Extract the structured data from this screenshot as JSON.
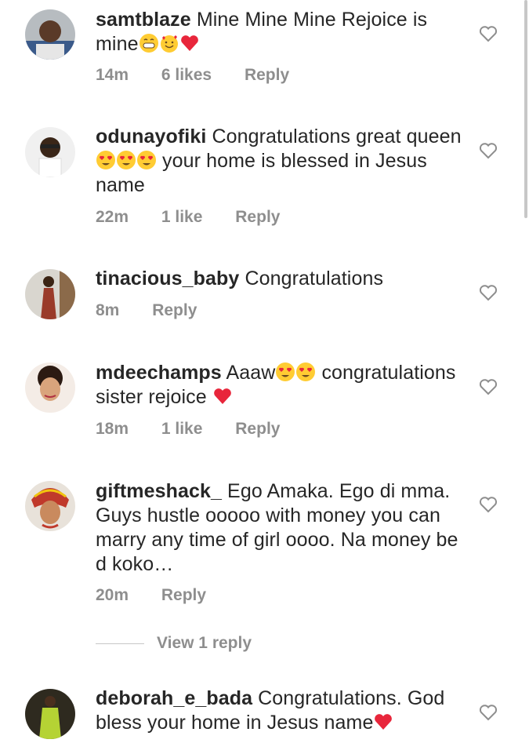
{
  "comments": [
    {
      "username": "samtblaze",
      "text_before": "Mine Mine Mine Rejoice is mine",
      "emojis": [
        "grinning-face",
        "smiling-face-with-hearts",
        "red-heart"
      ],
      "time": "14m",
      "likes": "6 likes",
      "reply": "Reply"
    },
    {
      "username": "odunayofiki",
      "text_before": "Congratulations great queen ",
      "emojis": [
        "heart-eyes",
        "heart-eyes",
        "heart-eyes"
      ],
      "text_after": " your home is blessed in Jesus name",
      "time": "22m",
      "likes": "1 like",
      "reply": "Reply"
    },
    {
      "username": "tinacious_baby",
      "text_before": "Congratulations",
      "time": "8m",
      "reply": "Reply"
    },
    {
      "username": "mdeechamps",
      "text_before": "Aaaw",
      "emojis": [
        "heart-eyes",
        "heart-eyes"
      ],
      "text_after": " congratulations sister rejoice ",
      "emojis_after": [
        "red-heart"
      ],
      "time": "18m",
      "likes": "1 like",
      "reply": "Reply"
    },
    {
      "username": "giftmeshack_",
      "text_before": "Ego Amaka. Ego di mma. Guys hustle ooooo with money you can marry any time of girl oooo.  Na money be d koko…",
      "time": "20m",
      "reply": "Reply"
    },
    {
      "username": "deborah_e_bada",
      "text_before": "Congratulations. God bless your home in Jesus name",
      "emojis": [
        "red-heart"
      ]
    }
  ],
  "view_replies": "View 1 reply",
  "colors": {
    "text": "#262626",
    "meta": "#8e8e8e",
    "heart_outline": "#8e8e8e"
  }
}
